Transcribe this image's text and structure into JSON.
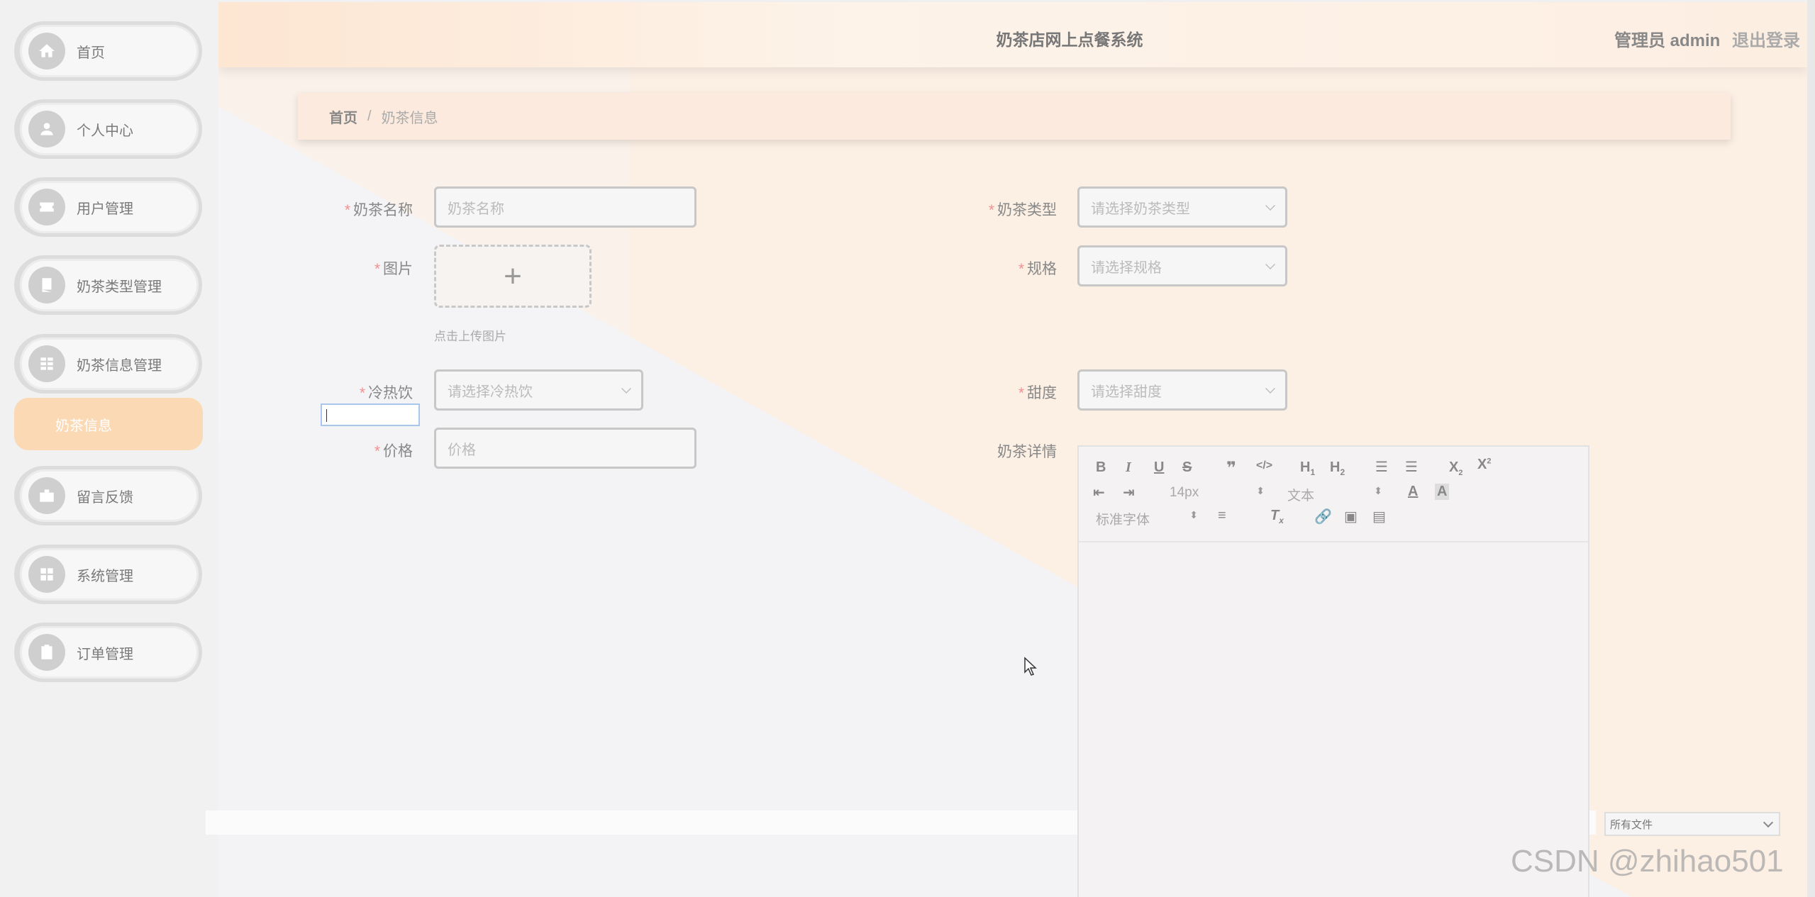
{
  "header": {
    "title": "奶茶店网上点餐系统",
    "user_label": "管理员 admin",
    "logout_label": "退出登录"
  },
  "sidebar": {
    "items": [
      {
        "label": "首页",
        "icon": "home-icon"
      },
      {
        "label": "个人中心",
        "icon": "user-icon"
      },
      {
        "label": "用户管理",
        "icon": "ticket-icon"
      },
      {
        "label": "奶茶类型管理",
        "icon": "book-icon"
      },
      {
        "label": "奶茶信息管理",
        "icon": "grid-icon"
      },
      {
        "label": "留言反馈",
        "icon": "briefcase-icon"
      },
      {
        "label": "系统管理",
        "icon": "apps-icon"
      },
      {
        "label": "订单管理",
        "icon": "clipboard-icon"
      }
    ],
    "active_sub_label": "奶茶信息"
  },
  "breadcrumb": {
    "home": "首页",
    "separator": "/",
    "current": "奶茶信息"
  },
  "form": {
    "name": {
      "label": "奶茶名称",
      "placeholder": "奶茶名称",
      "required": true
    },
    "type": {
      "label": "奶茶类型",
      "placeholder": "请选择奶茶类型",
      "required": true
    },
    "image": {
      "label": "图片",
      "hint": "点击上传图片",
      "required": true
    },
    "spec": {
      "label": "规格",
      "placeholder": "请选择规格",
      "required": true
    },
    "temp": {
      "label": "冷热饮",
      "placeholder": "请选择冷热饮",
      "required": true
    },
    "sweet": {
      "label": "甜度",
      "placeholder": "请选择甜度",
      "required": true
    },
    "price": {
      "label": "价格",
      "placeholder": "价格",
      "required": true
    },
    "detail": {
      "label": "奶茶详情",
      "required": false
    }
  },
  "editor": {
    "font_size": "14px",
    "paragraph": "文本",
    "font_family": "标准字体"
  },
  "file_select": {
    "value": "所有文件"
  },
  "watermark": "CSDN @zhihao501",
  "colors": {
    "accent": "#fbd9b4",
    "header_bg": "#fde6d2",
    "required": "#f29090"
  }
}
